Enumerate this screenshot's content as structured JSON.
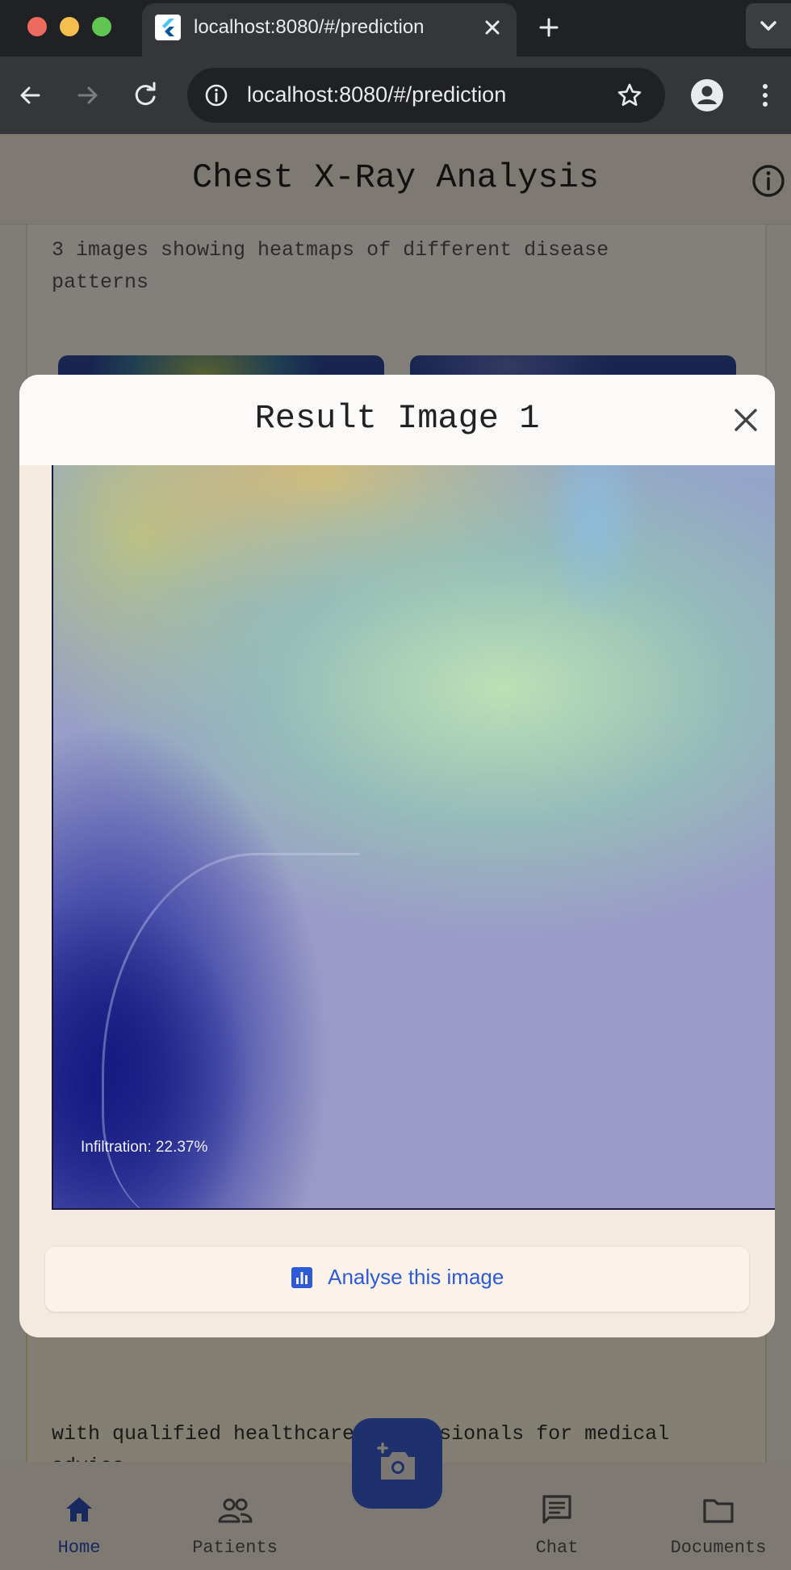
{
  "browser": {
    "tab_title": "localhost:8080/#/prediction",
    "url": "localhost:8080/#/prediction"
  },
  "app": {
    "title": "Chest X-Ray Analysis",
    "gallery_description": "3 images showing heatmaps of different disease patterns",
    "disclaimer_text": "with qualified healthcare professionals for medical advice."
  },
  "dialog": {
    "title": "Result Image 1",
    "heatmap_label": "Infiltration: 22.37%",
    "analyse_button_label": "Analyse this image"
  },
  "bottom_nav": {
    "items": [
      {
        "label": "Home",
        "icon": "home-icon",
        "active": true
      },
      {
        "label": "Patients",
        "icon": "people-icon",
        "active": false
      },
      {
        "label": "Chat",
        "icon": "chat-icon",
        "active": false
      },
      {
        "label": "Documents",
        "icon": "folder-icon",
        "active": false
      }
    ]
  },
  "colors": {
    "accent": "#2d5bd8",
    "fab": "#3a5fd0",
    "app_background": "#f3ece2"
  }
}
